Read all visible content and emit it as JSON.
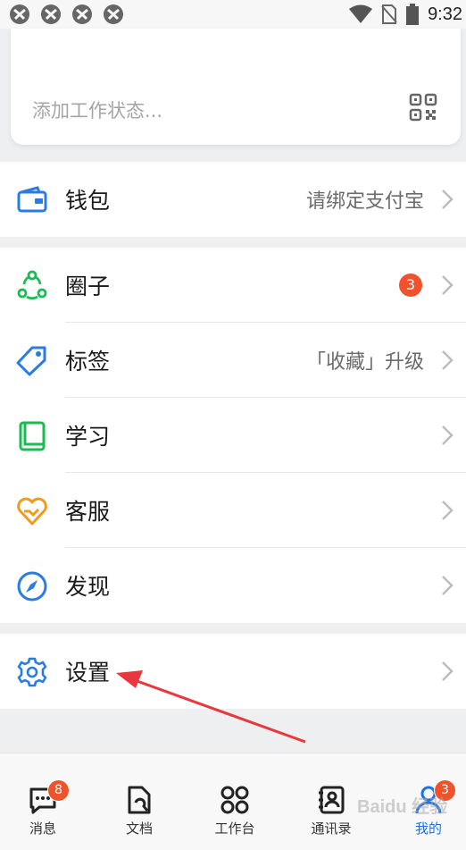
{
  "status_bar": {
    "time": "9:32",
    "notification_icons": [
      "app-notification-icon",
      "app-notification-icon",
      "app-notification-icon",
      "app-notification-icon"
    ],
    "system_icons": [
      "wifi-icon",
      "no-sim-icon",
      "battery-icon"
    ]
  },
  "profile_card": {
    "status_placeholder": "添加工作状态...",
    "qr_icon": "qr-code-icon"
  },
  "wallet": {
    "label": "钱包",
    "value": "请绑定支付宝",
    "icon": "wallet-icon",
    "icon_color": "#2a7be4"
  },
  "menu_items": [
    {
      "label": "圈子",
      "value": "",
      "badge": "3",
      "icon": "circle-group-icon",
      "icon_color": "#1db954"
    },
    {
      "label": "标签",
      "value": "「收藏」升级",
      "badge": "",
      "icon": "tag-icon",
      "icon_color": "#2a7be4"
    },
    {
      "label": "学习",
      "value": "",
      "badge": "",
      "icon": "book-icon",
      "icon_color": "#1db954"
    },
    {
      "label": "客服",
      "value": "",
      "badge": "",
      "icon": "customer-service-heart-icon",
      "icon_color": "#f29a1b"
    },
    {
      "label": "发现",
      "value": "",
      "badge": "",
      "icon": "compass-icon",
      "icon_color": "#2a7be4"
    }
  ],
  "settings": {
    "label": "设置",
    "icon": "gear-icon",
    "icon_color": "#2a7be4"
  },
  "annotation": {
    "arrow_color": "#e8383d"
  },
  "tab_bar": {
    "tabs": [
      {
        "label": "消息",
        "badge": "8",
        "icon": "message-icon",
        "active": false
      },
      {
        "label": "文档",
        "badge": "",
        "icon": "document-icon",
        "active": false
      },
      {
        "label": "工作台",
        "badge": "",
        "icon": "workbench-icon",
        "active": false
      },
      {
        "label": "通讯录",
        "badge": "",
        "icon": "contacts-icon",
        "active": false
      },
      {
        "label": "我的",
        "badge": "3",
        "icon": "profile-icon",
        "active": true
      }
    ],
    "active_color": "#1f6fe5"
  },
  "watermark": "Baidu 经验"
}
